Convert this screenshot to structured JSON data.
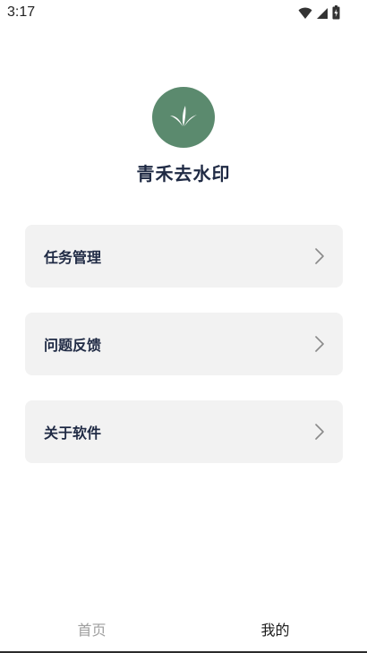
{
  "status_bar": {
    "time": "3:17",
    "icons": [
      "wifi-icon",
      "signal-icon",
      "battery-icon"
    ]
  },
  "app": {
    "name": "青禾去水印",
    "logo_icon": "sprout-icon",
    "logo_color": "#5b8a6e"
  },
  "menu": {
    "items": [
      {
        "label": "任务管理",
        "icon": "chevron-right-icon"
      },
      {
        "label": "问题反馈",
        "icon": "chevron-right-icon"
      },
      {
        "label": "关于软件",
        "icon": "chevron-right-icon"
      }
    ]
  },
  "tab_bar": {
    "tabs": [
      {
        "label": "首页",
        "active": false
      },
      {
        "label": "我的",
        "active": true
      }
    ],
    "active_color": "#1a1a1a",
    "inactive_color": "#9e9e9e"
  }
}
